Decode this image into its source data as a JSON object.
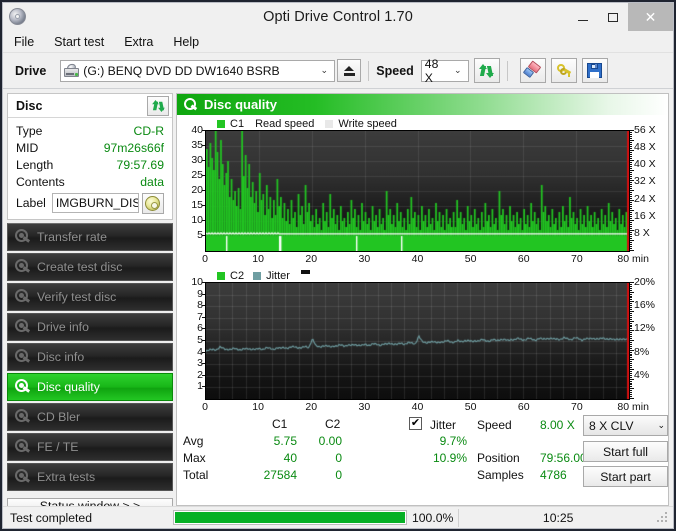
{
  "window": {
    "title": "Opti Drive Control 1.70",
    "minimize": "–",
    "maximize": "⬜",
    "close": "✕"
  },
  "menu": [
    "File",
    "Start test",
    "Extra",
    "Help"
  ],
  "toolbar": {
    "drive_label": "Drive",
    "drive_value": "(G:)   BENQ DVD DD DW1640 BSRB",
    "speed_label": "Speed",
    "speed_value": "48 X",
    "arrow": "⌄"
  },
  "disc": {
    "header": "Disc",
    "rows": [
      {
        "key": "Type",
        "value": "CD-R"
      },
      {
        "key": "MID",
        "value": "97m26s66f"
      },
      {
        "key": "Length",
        "value": "79:57.69"
      },
      {
        "key": "Contents",
        "value": "data"
      }
    ],
    "label_key": "Label",
    "label_value": "IMGBURN_DIS"
  },
  "nav": [
    {
      "label": "Transfer rate",
      "active": false
    },
    {
      "label": "Create test disc",
      "active": false
    },
    {
      "label": "Verify test disc",
      "active": false
    },
    {
      "label": "Drive info",
      "active": false
    },
    {
      "label": "Disc info",
      "active": false
    },
    {
      "label": "Disc quality",
      "active": true
    },
    {
      "label": "CD Bler",
      "active": false
    },
    {
      "label": "FE / TE",
      "active": false
    },
    {
      "label": "Extra tests",
      "active": false
    }
  ],
  "status_window_button": "Status window > >",
  "panel": {
    "title": "Disc quality"
  },
  "stats": {
    "col_c1": "C1",
    "col_c2": "C2",
    "row_avg": "Avg",
    "row_max": "Max",
    "row_total": "Total",
    "avg_c1": "5.75",
    "avg_c2": "0.00",
    "max_c1": "40",
    "max_c2": "0",
    "total_c1": "27584",
    "total_c2": "0",
    "jitter_label": "Jitter",
    "jitter_checked": "✔",
    "jitter_avg": "9.7%",
    "jitter_max": "10.9%",
    "speed_label": "Speed",
    "speed_value": "8.00 X",
    "position_label": "Position",
    "position_value": "79:56.00",
    "samples_label": "Samples",
    "samples_value": "4786",
    "write_speed_select": "8 X CLV",
    "start_full": "Start full",
    "start_part": "Start part"
  },
  "statusbar": {
    "message": "Test completed",
    "percent_text": "100.0%",
    "percent_value": 100,
    "time": "10:25"
  },
  "colors": {
    "c1_green": "#22c522",
    "jitter_teal": "#6f9ea2",
    "accent_green": "#0fa60f",
    "value_green": "#0a8a12",
    "marker_red": "#d01010",
    "progress_green": "#06b025"
  },
  "chart_data": [
    {
      "type": "bar",
      "name": "C1 errors / read speed",
      "title": "",
      "xlabel": "min",
      "ylabel": "",
      "legend": [
        {
          "label": "C1",
          "color": "#22c522"
        },
        {
          "label": "Read speed",
          "color": null
        },
        {
          "label": "Write speed",
          "color": "#e8e8e8"
        }
      ],
      "x": [
        0,
        10,
        20,
        30,
        40,
        50,
        60,
        70,
        80
      ],
      "xlim": [
        0,
        80
      ],
      "xticks": [
        "0",
        "10",
        "20",
        "30",
        "40",
        "50",
        "60",
        "70",
        "80 min"
      ],
      "yticks_left": [
        "5",
        "10",
        "15",
        "20",
        "25",
        "30",
        "35",
        "40"
      ],
      "ylim_left": [
        0,
        40
      ],
      "yticks_right": [
        "8 X",
        "16 X",
        "24 X",
        "32 X",
        "40 X",
        "48 X",
        "56 X"
      ],
      "ylim_right": [
        0,
        56
      ],
      "grid": true,
      "values": [
        34,
        28,
        36,
        31,
        27,
        40,
        33,
        24,
        37,
        29,
        22,
        26,
        30,
        18,
        24,
        17,
        20,
        15,
        21,
        14,
        40,
        25,
        32,
        21,
        29,
        18,
        23,
        16,
        20,
        13,
        26,
        17,
        19,
        12,
        22,
        14,
        18,
        11,
        17,
        12,
        24,
        15,
        18,
        11,
        16,
        10,
        14,
        9,
        17,
        11,
        13,
        8,
        19,
        12,
        15,
        9,
        22,
        13,
        16,
        10,
        12,
        8,
        14,
        9,
        11,
        7,
        16,
        10,
        13,
        8,
        19,
        11,
        14,
        9,
        12,
        7,
        15,
        10,
        11,
        8,
        13,
        9,
        17,
        11,
        14,
        8,
        12,
        7,
        16,
        10,
        13,
        9,
        11,
        7,
        15,
        10,
        12,
        8,
        14,
        9,
        11,
        7,
        20,
        12,
        14,
        9,
        12,
        8,
        16,
        10,
        13,
        8,
        11,
        7,
        14,
        9,
        18,
        11,
        13,
        8,
        12,
        7,
        15,
        10,
        12,
        8,
        14,
        9,
        11,
        7,
        16,
        10,
        13,
        8,
        12,
        7,
        14,
        9,
        11,
        8,
        13,
        8,
        17,
        11,
        13,
        9,
        11,
        7,
        15,
        10,
        12,
        8,
        14,
        9,
        11,
        7,
        13,
        8,
        16,
        10,
        12,
        8,
        14,
        9,
        11,
        7,
        20,
        12,
        14,
        9,
        12,
        7,
        15,
        10,
        12,
        8,
        13,
        9,
        11,
        7,
        14,
        9,
        12,
        8,
        16,
        10,
        13,
        9,
        11,
        7,
        22,
        13,
        15,
        10,
        12,
        8,
        14,
        9,
        11,
        7,
        13,
        8,
        15,
        10,
        12,
        8,
        18,
        11,
        13,
        9,
        11,
        7,
        14,
        9,
        12,
        8,
        15,
        10,
        12,
        8,
        13,
        9,
        11,
        7,
        14,
        9,
        12,
        8,
        16,
        10,
        13,
        9,
        11,
        7,
        14,
        9,
        12,
        8,
        13,
        9
      ],
      "read_speed_line": {
        "color": "#ffffff",
        "note": "stepped CAV/CLV read speed trace, ~8X flat then rising"
      }
    },
    {
      "type": "line",
      "name": "C2 errors / Jitter",
      "title": "",
      "xlabel": "min",
      "ylabel": "",
      "legend": [
        {
          "label": "C2",
          "color": "#22c522"
        },
        {
          "label": "Jitter",
          "color": "#6f9ea2"
        }
      ],
      "x": [
        0,
        10,
        20,
        30,
        40,
        50,
        60,
        70,
        80
      ],
      "xlim": [
        0,
        80
      ],
      "xticks": [
        "0",
        "10",
        "20",
        "30",
        "40",
        "50",
        "60",
        "70",
        "80 min"
      ],
      "yticks_left": [
        "1",
        "2",
        "3",
        "4",
        "5",
        "6",
        "7",
        "8",
        "9",
        "10"
      ],
      "ylim_left": [
        0,
        10
      ],
      "yticks_right": [
        "4%",
        "8%",
        "12%",
        "16%",
        "20%"
      ],
      "ylim_right": [
        0,
        20
      ],
      "grid": true,
      "series": [
        {
          "name": "Jitter",
          "color": "#6f9ea2",
          "unit": "%",
          "values": [
            8.2,
            8.4,
            8.6,
            8.5,
            8.9,
            8.7,
            8.6,
            8.5,
            8.7,
            8.6,
            8.5,
            8.6,
            8.7,
            8.6,
            8.5,
            8.7,
            8.6,
            8.8,
            8.7,
            8.6,
            8.8,
            8.7,
            8.9,
            8.8,
            8.9,
            9.0,
            8.9,
            8.8,
            9.0,
            8.9,
            10.4,
            9.1,
            9.0,
            9.2,
            9.1,
            9.0,
            9.2,
            9.1,
            9.3,
            9.2,
            9.3,
            9.2,
            9.4,
            9.3,
            9.2,
            9.4,
            9.3,
            9.5,
            9.4,
            9.3,
            9.5,
            9.4,
            9.6,
            9.5,
            9.4,
            9.6,
            9.5,
            9.7,
            9.6,
            9.5,
            10.9,
            9.8,
            9.7,
            9.9,
            9.8,
            9.7,
            9.9,
            9.8,
            10.0,
            9.9,
            9.8,
            10.0,
            9.9,
            10.1,
            10.0,
            9.9,
            10.1,
            10.0,
            10.2,
            10.1,
            10.0,
            10.2,
            10.1,
            10.3,
            10.2,
            10.1,
            10.3,
            10.2,
            10.4,
            10.3,
            10.2,
            10.4,
            10.3,
            10.2,
            10.4,
            10.3,
            10.5,
            10.4,
            10.3,
            10.4,
            10.3,
            10.5,
            10.4,
            10.3,
            10.5,
            10.4,
            10.2,
            10.4,
            10.3,
            10.5,
            10.4,
            10.3,
            10.5,
            10.4,
            10.3,
            10.2,
            10.4,
            10.3,
            10.2,
            10.3
          ]
        },
        {
          "name": "C2",
          "color": "#22c522",
          "unit": "errors",
          "values": []
        }
      ]
    }
  ]
}
